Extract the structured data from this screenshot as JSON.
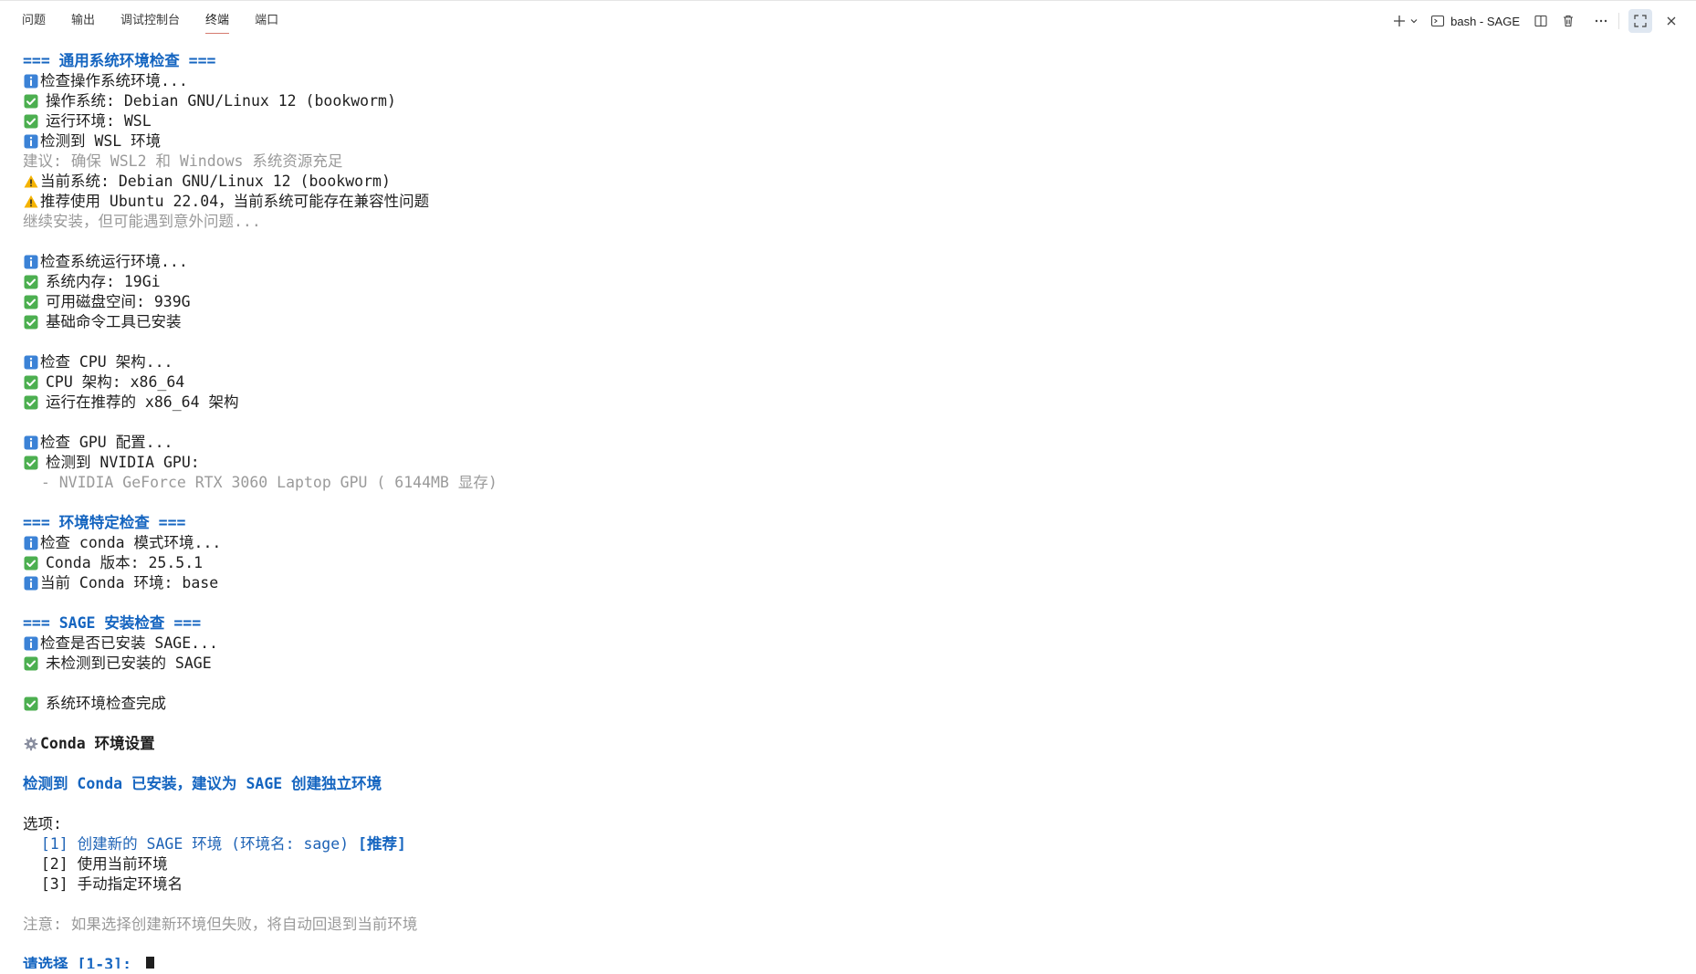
{
  "panel": {
    "tabs": [
      {
        "label": "问题"
      },
      {
        "label": "输出"
      },
      {
        "label": "调试控制台"
      },
      {
        "label": "终端",
        "active": true
      },
      {
        "label": "端口"
      }
    ],
    "toolbar": {
      "terminal_name": "bash - SAGE",
      "icons": [
        "plus-icon",
        "chevron-down-icon",
        "terminal-icon",
        "split-icon",
        "trash-icon",
        "more-icon",
        "maximize-icon",
        "close-icon"
      ]
    }
  },
  "colors": {
    "heading": "#1565c0",
    "ok_icon": "#4caf50",
    "info_icon": "#3b82d6",
    "warn_icon": "#f5b301",
    "muted": "#9a9a9a",
    "tab_active_underline": "#d67b6f"
  },
  "terminal": {
    "lines": [
      {
        "icon": null,
        "style": "head",
        "text": "=== 通用系统环境检查 ==="
      },
      {
        "icon": "info-icon",
        "style": "norm",
        "text": "检查操作系统环境..."
      },
      {
        "icon": "check-icon",
        "style": "norm",
        "text": "操作系统: Debian GNU/Linux 12 (bookworm)"
      },
      {
        "icon": "check-icon",
        "style": "norm",
        "text": "运行环境: WSL"
      },
      {
        "icon": "info-icon",
        "style": "norm",
        "text": "检测到 WSL 环境"
      },
      {
        "icon": null,
        "style": "gray",
        "text": "建议: 确保 WSL2 和 Windows 系统资源充足"
      },
      {
        "icon": "warning-icon",
        "style": "norm",
        "text": "当前系统: Debian GNU/Linux 12 (bookworm)"
      },
      {
        "icon": "warning-icon",
        "style": "norm",
        "text": "推荐使用 Ubuntu 22.04，当前系统可能存在兼容性问题"
      },
      {
        "icon": null,
        "style": "gray",
        "text": "继续安装，但可能遇到意外问题..."
      },
      {
        "blank": true
      },
      {
        "icon": "info-icon",
        "style": "norm",
        "text": "检查系统运行环境..."
      },
      {
        "icon": "check-icon",
        "style": "norm",
        "text": "系统内存: 19Gi"
      },
      {
        "icon": "check-icon",
        "style": "norm",
        "text": "可用磁盘空间: 939G"
      },
      {
        "icon": "check-icon",
        "style": "norm",
        "text": "基础命令工具已安装"
      },
      {
        "blank": true
      },
      {
        "icon": "info-icon",
        "style": "norm",
        "text": "检查 CPU 架构..."
      },
      {
        "icon": "check-icon",
        "style": "norm",
        "text": "CPU 架构: x86_64"
      },
      {
        "icon": "check-icon",
        "style": "norm",
        "text": "运行在推荐的 x86_64 架构"
      },
      {
        "blank": true
      },
      {
        "icon": "info-icon",
        "style": "norm",
        "text": "检查 GPU 配置..."
      },
      {
        "icon": "check-icon",
        "style": "norm",
        "text": "检测到 NVIDIA GPU:"
      },
      {
        "icon": null,
        "style": "gray",
        "text": "  - NVIDIA GeForce RTX 3060 Laptop GPU ( 6144MB 显存)"
      },
      {
        "blank": true
      },
      {
        "icon": null,
        "style": "head",
        "text": "=== 环境特定检查 ==="
      },
      {
        "icon": "info-icon",
        "style": "norm",
        "text": "检查 conda 模式环境..."
      },
      {
        "icon": "check-icon",
        "style": "norm",
        "text": "Conda 版本: 25.5.1"
      },
      {
        "icon": "info-icon",
        "style": "norm",
        "text": "当前 Conda 环境: base"
      },
      {
        "blank": true
      },
      {
        "icon": null,
        "style": "head",
        "text": "=== SAGE 安装检查 ==="
      },
      {
        "icon": "info-icon",
        "style": "norm",
        "text": "检查是否已安装 SAGE..."
      },
      {
        "icon": "check-icon",
        "style": "norm",
        "text": "未检测到已安装的 SAGE"
      },
      {
        "blank": true
      },
      {
        "icon": "check-icon",
        "style": "norm",
        "text": "系统环境检查完成"
      },
      {
        "blank": true
      },
      {
        "icon": "gear-icon",
        "style": "bold",
        "text": "Conda 环境设置"
      },
      {
        "blank": true
      },
      {
        "icon": null,
        "style": "bluebold",
        "text": "检测到 Conda 已安装，建议为 SAGE 创建独立环境"
      },
      {
        "blank": true
      },
      {
        "icon": null,
        "style": "norm",
        "text": "选项:"
      },
      {
        "icon": null,
        "style": "blue",
        "text": "  [1] 创建新的 SAGE 环境 (环境名: sage)",
        "suffix": " [推荐]"
      },
      {
        "icon": null,
        "style": "norm",
        "text": "  [2] 使用当前环境"
      },
      {
        "icon": null,
        "style": "norm",
        "text": "  [3] 手动指定环境名"
      },
      {
        "blank": true
      },
      {
        "icon": null,
        "style": "gray",
        "text": "注意: 如果选择创建新环境但失败，将自动回退到当前环境"
      },
      {
        "blank": true
      },
      {
        "icon": null,
        "style": "bluebold",
        "text": "请选择 [1-3]: ",
        "cursor": true
      }
    ]
  }
}
